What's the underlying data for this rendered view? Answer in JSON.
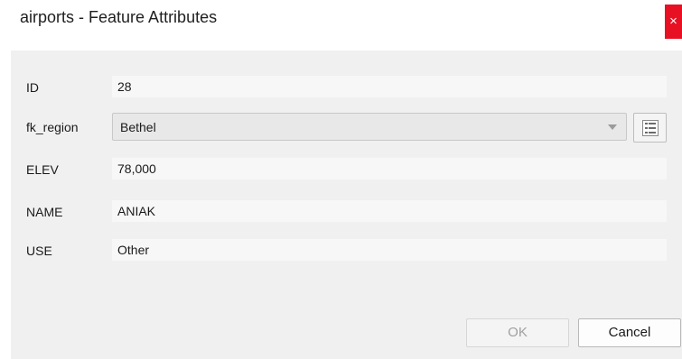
{
  "window": {
    "title": "airports - Feature Attributes",
    "close_glyph": "×"
  },
  "fields": {
    "id": {
      "label": "ID",
      "value": "28"
    },
    "fk_region": {
      "label": "fk_region",
      "value": "Bethel",
      "icon": "chevron-down-icon"
    },
    "elev": {
      "label": "ELEV",
      "value": "78,000"
    },
    "name": {
      "label": "NAME",
      "value": "ANIAK"
    },
    "use": {
      "label": "USE",
      "value": "Other"
    }
  },
  "form_button": {
    "icon": "open-form-icon"
  },
  "buttons": {
    "ok": "OK",
    "cancel": "Cancel"
  },
  "colors": {
    "close_bg": "#e81123",
    "content_bg": "#f0f0f0"
  }
}
